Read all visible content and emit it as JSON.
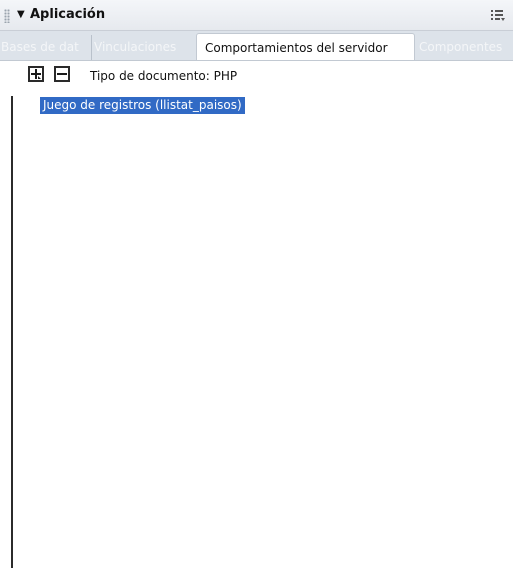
{
  "panel": {
    "title": "Aplicación",
    "collapse_glyph": "▼",
    "options_icon": "panel-options-icon"
  },
  "tabs": [
    {
      "label": "Bases de dat",
      "active": false
    },
    {
      "label": "Vinculaciones",
      "active": false
    },
    {
      "label": "Comportamientos del servidor",
      "active": true
    },
    {
      "label": "Componentes",
      "active": false
    }
  ],
  "toolbar": {
    "add_icon": "plus-icon",
    "remove_icon": "minus-icon",
    "document_type": "Tipo de documento: PHP"
  },
  "behaviors": [
    {
      "label": "Juego de registros (llistat_paisos)",
      "selected": true
    }
  ],
  "colors": {
    "selection": "#316ac5",
    "tabbar": "#dde3ea",
    "titlebar": "#e6e9ee"
  }
}
